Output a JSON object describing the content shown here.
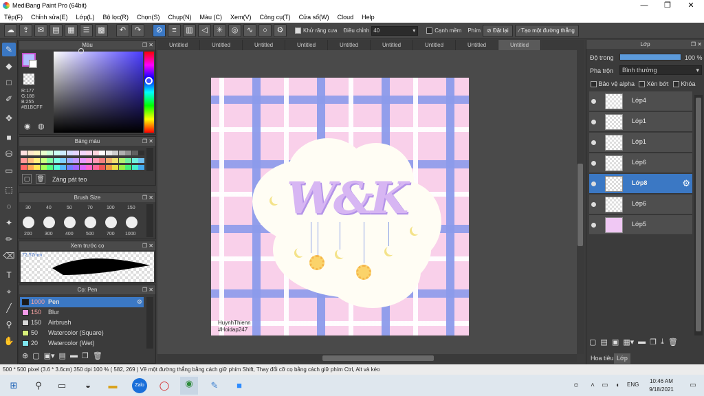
{
  "window": {
    "title": "MediBang Paint Pro (64bit)"
  },
  "menu": [
    "Tệp(F)",
    "Chỉnh sửa(E)",
    "Lớp(L)",
    "Bộ lọc(R)",
    "Chọn(S)",
    "Chụp(N)",
    "Màu (C)",
    "Xem(V)",
    "Công cụ(T)",
    "Cửa sổ(W)",
    "Cloud",
    "Help"
  ],
  "toolbar": {
    "antialias_label": "Khử răng cưa",
    "adjust_label": "Điều chỉnh",
    "adjust_value": "40",
    "smooth_label": "Cạnh mềm",
    "key_label": "Phím",
    "reset_label": "Đặt lại",
    "line_label": "Tạo một đường thẳng"
  },
  "color_panel": {
    "title": "Màu",
    "r": "R:177",
    "g": "G:188",
    "b": "B:255",
    "hex": "#B1BCFF",
    "current_color": "#B1BCFF"
  },
  "palette_panel": {
    "title": "Bảng màu",
    "name": "Zàng pát teo"
  },
  "brushsize_panel": {
    "title": "Brush Size",
    "row1": [
      "30",
      "40",
      "50",
      "70",
      "100",
      "150"
    ],
    "row2": [
      "200",
      "300",
      "400",
      "500",
      "700",
      "1000"
    ]
  },
  "preview_panel": {
    "title": "Xem trước cọ",
    "size": "72.57mm"
  },
  "pen_panel": {
    "title": "Cọ: Pen",
    "brushes": [
      {
        "size": "1000",
        "name": "Pen",
        "color": "#1a1a1a"
      },
      {
        "size": "150",
        "name": "Blur",
        "color": "#f39ae9"
      },
      {
        "size": "150",
        "name": "Airbrush",
        "color": "#d8d8d8"
      },
      {
        "size": "50",
        "name": "Watercolor (Square)",
        "color": "#d8f07a"
      },
      {
        "size": "20",
        "name": "Watercolor (Wet)",
        "color": "#7fe6ee"
      }
    ]
  },
  "tabs": [
    "Untitled",
    "Untitled",
    "Untitled",
    "Untitled",
    "Untitled",
    "Untitled",
    "Untitled",
    "Untitled",
    "Untitled"
  ],
  "artwork": {
    "text": "W&K",
    "sig1": "HuynhThienn",
    "sig2": "#Hoidap247"
  },
  "layer_panel": {
    "title": "Lớp",
    "opacity_label": "Độ trong",
    "opacity_value": "100 %",
    "blend_label": "Pha trộn",
    "blend_value": "Bình thường",
    "protect_alpha": "Bảo vệ alpha",
    "clip": "Xén bớt",
    "lock": "Khóa",
    "layers": [
      "Lớp4",
      "Lớp1",
      "Lớp1",
      "Lớp6",
      "Lớp8",
      "Lớp6",
      "Lớp5"
    ],
    "tab_material": "Hoa tiêu",
    "tab_layer": "Lớp"
  },
  "status": {
    "text": "500 * 500 pixel   (3.6 * 3.6cm)   350 dpi   100 %   ( 582, 269 )   Vẽ một đường thẳng bằng cách giữ phím Shift, Thay đổi cỡ cọ bằng cách giữ phím Ctrl, Alt và kéo"
  },
  "taskbar": {
    "lang": "ENG",
    "time": "10:46 AM",
    "date": "9/18/2021"
  }
}
